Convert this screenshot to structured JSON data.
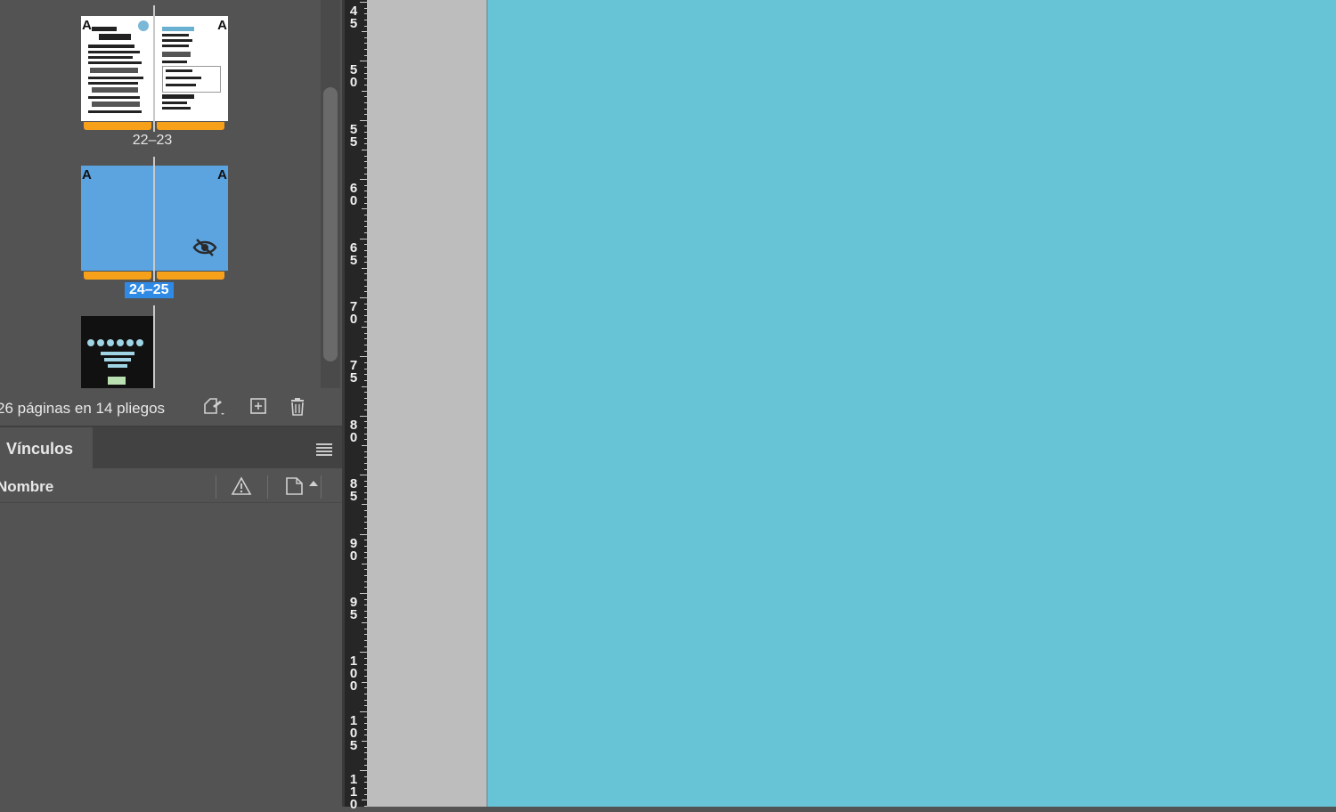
{
  "pages_panel": {
    "spreads": [
      {
        "label": "22–23",
        "left_master": "A",
        "right_master": "A",
        "selected": false
      },
      {
        "label": "24–25",
        "left_master": "A",
        "right_master": "A",
        "selected": true,
        "hidden_icon": "eye-slash-icon"
      }
    ],
    "status_text": "26 páginas en 14 pliegos",
    "footer_icons": [
      "edit-page-size-icon",
      "new-page-icon",
      "delete-page-icon"
    ]
  },
  "links_panel": {
    "tab_label": "Vínculos",
    "column_name": "Nombre",
    "column_icons": [
      "warning-icon",
      "page-icon",
      "sort-up-icon"
    ]
  },
  "ruler": {
    "labels": [
      "45",
      "50",
      "55",
      "60",
      "65",
      "70",
      "75",
      "80",
      "85",
      "90",
      "95",
      "100",
      "105",
      "110"
    ]
  },
  "colors": {
    "panel_bg": "#535353",
    "accent_selected": "#2f8ae6",
    "master_bar": "#f7a11b",
    "thumb_blue": "#5ba4e0",
    "canvas_page": "#67c4d7",
    "pasteboard": "#bdbdbd"
  }
}
